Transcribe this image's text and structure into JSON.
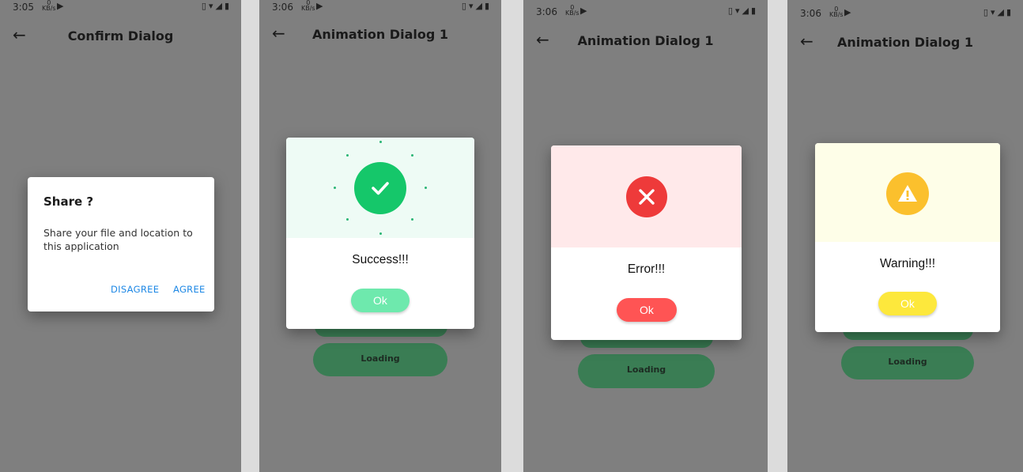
{
  "status": {
    "time1": "3:05",
    "time2": "3:06",
    "time3": "3:06",
    "time4": "3:06",
    "kbs_top": "0",
    "kbs_bottom": "KB/s"
  },
  "screens": [
    {
      "title": "Confirm Dialog",
      "dialog": {
        "title": "Share ?",
        "message": "Share your file and location to this application",
        "disagree": "DISAGREE",
        "agree": "AGREE"
      }
    },
    {
      "title": "Animation Dialog 1",
      "dialog": {
        "message": "Success!!!",
        "ok": "Ok"
      },
      "bg_button": "Loading"
    },
    {
      "title": "Animation Dialog 1",
      "dialog": {
        "message": "Error!!!",
        "ok": "Ok"
      },
      "bg_button": "Loading"
    },
    {
      "title": "Animation Dialog 1",
      "dialog": {
        "message": "Warning!!!",
        "ok": "Ok"
      },
      "bg_button": "Loading"
    }
  ],
  "icons": [
    "back-arrow-icon",
    "check-icon",
    "close-icon",
    "warning-icon",
    "play-store-icon",
    "vibrate-icon",
    "wifi-icon",
    "signal-icon",
    "battery-icon"
  ],
  "colors": {
    "success": "#15c76a",
    "success_ok": "#6ee9ad",
    "error": "#ee3a3a",
    "error_ok": "#ff5454",
    "warning": "#fbc02d",
    "warning_ok": "#fde83c",
    "link": "#1e88e5"
  }
}
